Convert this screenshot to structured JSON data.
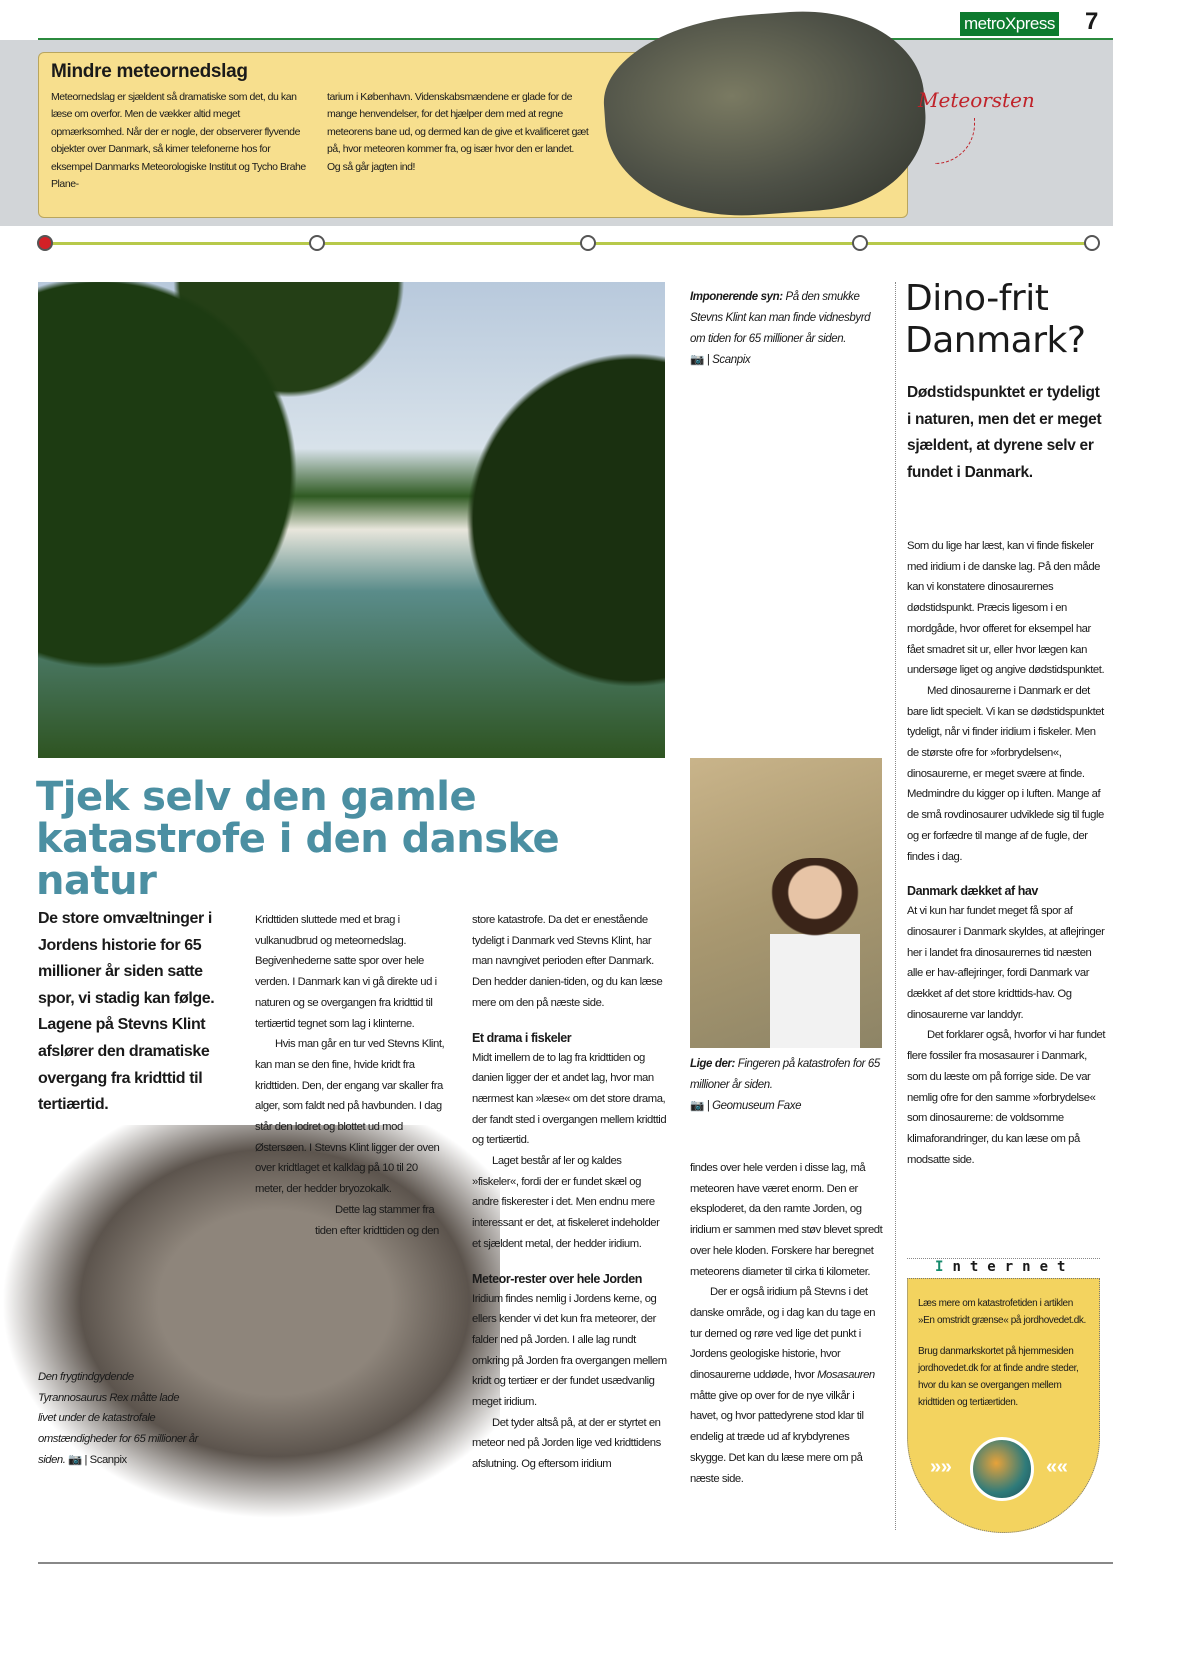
{
  "header": {
    "brand": "metroXpress",
    "page_number": "7"
  },
  "sidebox": {
    "title": "Mindre meteornedslag",
    "col1": "Meteornedslag er sjældent så dramatiske som det, du kan læse om overfor. Men de vækker altid meget opmærksomhed. Når der er nogle, der observerer flyvende objekter over Danmark, så kimer telefonerne hos for eksempel Danmarks Meteorologiske Institut og Tycho Brahe Plane-",
    "col2": "tarium i København. Videnskabsmændene er glade for de mange henvendelser, for det hjælper dem med at regne meteorens bane ud, og dermed kan de give et kvalificeret gæt på, hvor meteoren kommer fra, og især hvor den er landet. Og så går jagten ind!",
    "rock_label": "Meteorsten"
  },
  "photo1_caption": {
    "lead": "Imponerende syn:",
    "text": " På den smukke Stevns Klint kan man finde vidnesbyrd om tiden for 65 millioner år siden.",
    "camera_icon": "camera-icon",
    "credit": "| Scanpix"
  },
  "headline": "Tjek selv den gamle katastrofe i den danske natur",
  "lead": "De store omvæltninger i Jordens historie for 65 millioner år siden satte spor, vi stadig kan følge. Lagene på Stevns Klint afslører den dramatiske overgang fra kridttid til tertiærtid.",
  "col2": {
    "p1": "Kridttiden sluttede med et brag i vulkanudbrud og meteornedslag. Begivenhederne satte spor over hele verden. I Danmark kan vi gå direkte ud i naturen og se overgangen fra kridttid til tertiærtid tegnet som lag i klinterne.",
    "p2": "Hvis man går en tur ved Stevns Klint, kan man se den fine, hvide kridt fra kridttiden. Den, der engang var skaller fra alger, som faldt ned på havbunden. I dag står den lodret og blottet ud mod Østersøen. I Stevns Klint ligger der oven over kridtlaget et kalklag på 10 til 20 meter, der hedder bryozokalk.",
    "p3": "Dette lag stammer fra tiden efter kridttiden og den"
  },
  "col3": {
    "p1": "store katastrofe. Da det er enestående tydeligt i Danmark ved Stevns Klint, har man navngivet perioden efter Danmark. Den hedder danien-tiden, og du kan læse mere om den på næste side.",
    "h1": "Et drama i fiskeler",
    "p2": "Midt imellem de to lag fra kridttiden og danien ligger der et andet lag, hvor man nærmest kan »læse« om det store drama, der fandt sted i overgangen mellem kridttid og tertiærtid.",
    "p3": "Laget består af ler og kaldes »fiskeler«, fordi der er fundet skæl og andre fiskerester i det. Men endnu mere interessant er det, at fiskeleret indeholder et sjældent metal, der hedder iridium.",
    "h2": "Meteor-rester over hele Jorden",
    "p4": "Iridium findes nemlig i Jordens kerne, og ellers kender vi det kun fra meteorer, der falder ned på Jorden. I alle lag rundt omkring på Jorden fra overgangen mellem kridt og tertiær er der fundet usædvanlig meget iridium.",
    "p5": "Det tyder altså på, at der er styrtet en meteor ned på Jorden lige ved kridttidens afslutning. Og eftersom iridium"
  },
  "photo2_caption": {
    "lead": "Lige der:",
    "text": " Fingeren på katastrofen for 65 millioner år siden.",
    "credit": "| Geomuseum Faxe"
  },
  "col4": {
    "p1": "findes over hele verden i disse lag, må meteoren have været enorm. Den er eksploderet, da den ramte Jorden, og iridium er sammen med støv blevet spredt over hele kloden. Forskere har beregnet meteorens diameter til cirka ti kilometer.",
    "p2a": "Der er også iridium på Stevns i det danske område, og i dag kan du tage en tur derned og røre ved lige det punkt i Jordens geologiske historie, hvor dinosaurerne uddøde, hvor ",
    "p2i": "Mosasauren",
    "p2b": " måtte give op over for de nye vilkår i havet, og hvor pattedyrene stod klar til endelig at træde ud af krybdyrenes skygge. Det kan du læse mere om på næste side."
  },
  "dino_caption": {
    "text": "Den frygtindgydende Tyrannosaurus Rex måtte lade livet under de katastrofale omstændigheder for 65 millioner år siden.",
    "credit": "| Scanpix"
  },
  "sidebar": {
    "title": "Dino-frit Danmark?",
    "lead": "Dødstidspunktet er tydeligt i naturen, men det er meget sjældent, at dyrene selv er fundet i Danmark.",
    "p1": "Som du lige har læst, kan vi finde fiskeler med iridium i de danske lag. På den måde kan vi konstatere dinosaurernes dødstidspunkt. Præcis ligesom i en mordgåde, hvor offeret for eksempel har fået smadret sit ur, eller hvor lægen kan undersøge liget og angive dødstidspunktet.",
    "p2": "Med dinosaurerne i Danmark er det bare lidt specielt. Vi kan se dødstidspunktet tydeligt, når vi finder iridium i fiskeler. Men de største ofre for »forbrydelsen«, dinosaurerne, er meget svære at finde. Medmindre du kigger op i luften. Mange af de små rovdinosaurer udviklede sig til fugle og er forfædre til mange af de fugle, der findes i dag.",
    "h1": "Danmark dækket af hav",
    "p3": "At vi kun har fundet meget få spor af dinosaurer i Danmark skyldes, at aflejringer her i landet fra dinosaurernes tid næsten alle er hav-aflejringer, fordi Danmark var dækket af det store kridttids-hav. Og dinosaurerne var landdyr.",
    "p4": "Det forklarer også, hvorfor vi har fundet flere fossiler fra mosasaurer i Danmark, som du læste om på forrige side. De var nemlig ofre for den samme »forbrydelse« som dinosaurerne: de voldsomme klimaforandringer, du kan læse om på modsatte side."
  },
  "internet": {
    "first_letter": "I",
    "rest": "nternet",
    "p1": "Læs mere om katastrofetiden i artiklen »En omstridt grænse« på jordhovedet.dk.",
    "p2": "Brug danmarkskortet på hjemmesiden jordhovedet.dk for at finde andre steder, hvor du kan se overgangen mellem kridttiden og tertiærtiden."
  },
  "colors": {
    "headline": "#4b8fa2",
    "brand": "#0d7a2e",
    "box": "#f7df8e",
    "internet_box": "#f3d35f"
  }
}
